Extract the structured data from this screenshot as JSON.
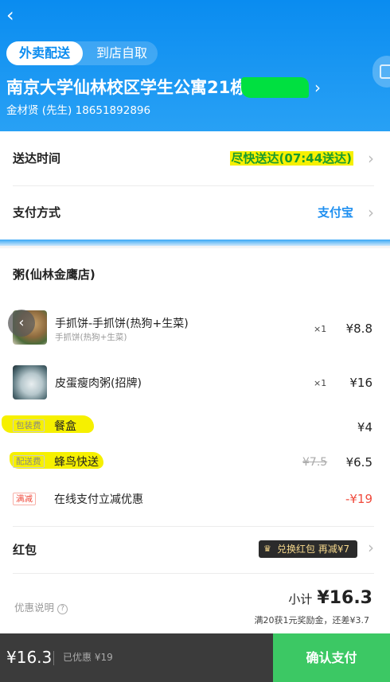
{
  "header": {
    "back_icon": "chevron-left-icon",
    "tabs": {
      "active": "外卖配送",
      "other": "到店自取"
    },
    "address": "南京大学仙林校区学生公寓21栋",
    "contact": "金材贤 (先生)  18651892896",
    "colors": {
      "gradient_top": "#0a8cf0",
      "gradient_bottom": "#2aa2f5"
    }
  },
  "delivery": {
    "time_label": "送达时间",
    "time_value": "尽快送达(07:44送达)",
    "pay_label": "支付方式",
    "pay_value": "支付宝"
  },
  "order": {
    "store": "粥(仙林金鹰店)",
    "items": [
      {
        "name": "手抓饼-手抓饼(热狗+生菜)",
        "sub": "手抓饼(热狗+生菜)",
        "qty": "×1",
        "price": "¥8.8"
      },
      {
        "name": "皮蛋瘦肉粥(招牌)",
        "qty": "×1",
        "price": "¥16"
      }
    ],
    "fees": {
      "packing": {
        "tag": "包装费",
        "name": "餐盒",
        "price": "¥4"
      },
      "delivery": {
        "tag": "配送费",
        "name": "蜂鸟快送",
        "original": "¥7.5",
        "price": "¥6.5"
      },
      "discount": {
        "tag": "满减",
        "name": "在线支付立减优惠",
        "price": "-¥19"
      }
    },
    "red_packet": {
      "label": "红包",
      "coupon": "兑换红包 再减¥7"
    },
    "promo_note": "优惠说明",
    "subtotal_label": "小计",
    "subtotal": "¥16.3",
    "bonus": "满20获1元奖励金，还差¥3.7"
  },
  "bottom": {
    "total": "¥16.3",
    "saved": "已优惠 ¥19",
    "pay_button": "确认支付",
    "colors": {
      "bar": "#3b3b3b",
      "pay": "#3cc864"
    }
  },
  "accent_colors": {
    "blue": "#1e8ff0",
    "green": "#3cc864",
    "red": "#f04b3d",
    "highlight": "#f6f000"
  }
}
